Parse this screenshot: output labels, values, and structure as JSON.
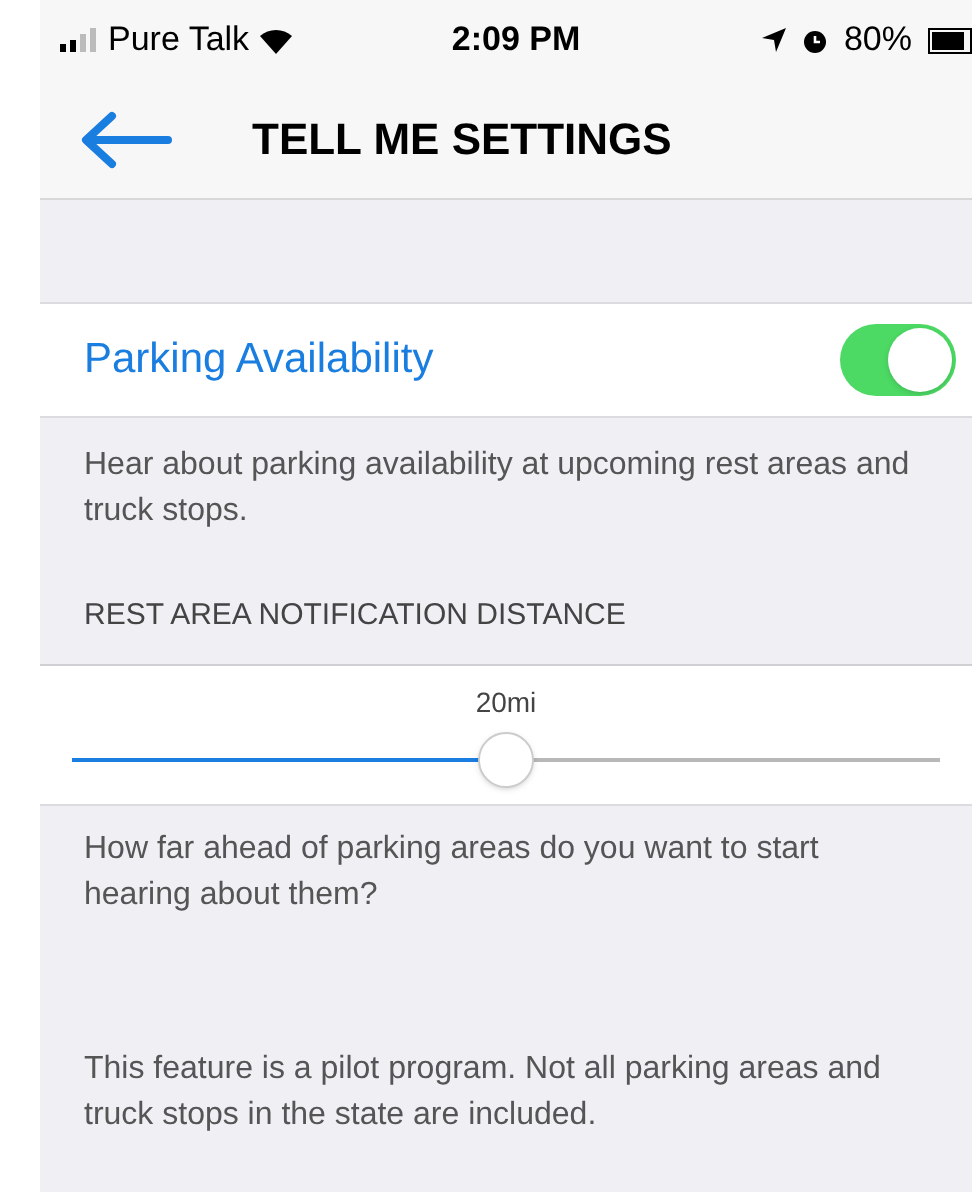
{
  "status_bar": {
    "carrier": "Pure Talk",
    "time": "2:09 PM",
    "battery": "80%"
  },
  "nav": {
    "title": "TELL ME SETTINGS"
  },
  "toggle": {
    "label": "Parking Availability",
    "on": true
  },
  "toggle_description": "Hear about parking availability at upcoming rest areas and truck stops.",
  "section_header": "REST AREA NOTIFICATION DISTANCE",
  "slider": {
    "reading": "20mi",
    "level": 0.5
  },
  "slider_description": "How far ahead of parking areas do you want to start hearing about them?",
  "footnote": "This feature is a pilot program. Not all parking areas and truck stops in the state are included."
}
